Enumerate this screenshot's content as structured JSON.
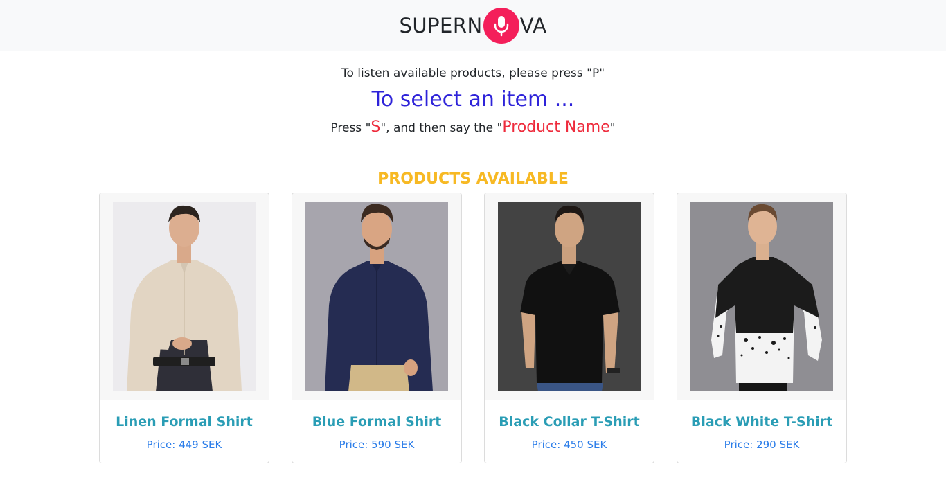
{
  "brand": {
    "left": "SUPERN",
    "right": "VA",
    "icon": "microphone-icon",
    "icon_color": "#f41f5a"
  },
  "instructions": {
    "line1": "To listen available products, please press \"P\"",
    "line2": "To select an item ...",
    "line3_part1": "Press \"",
    "line3_key": "S",
    "line3_part2": "\", and then say the \"",
    "line3_product": "Product Name",
    "line3_part3": "\""
  },
  "section_title": "PRODUCTS AVAILABLE",
  "products": [
    {
      "name": "Linen Formal Shirt",
      "price": "Price: 449 SEK",
      "image": "linen-shirt-photo"
    },
    {
      "name": "Blue Formal Shirt",
      "price": "Price: 590 SEK",
      "image": "blue-shirt-photo"
    },
    {
      "name": "Black Collar T-Shirt",
      "price": "Price: 450 SEK",
      "image": "black-polo-photo"
    },
    {
      "name": "Black White T-Shirt",
      "price": "Price: 290 SEK",
      "image": "black-white-tee-photo"
    }
  ],
  "colors": {
    "accent_blue": "#2e23d9",
    "accent_red": "#ee2b3c",
    "title_yellow": "#f7b924",
    "product_title": "#2a9db5",
    "price": "#2b7de9"
  }
}
